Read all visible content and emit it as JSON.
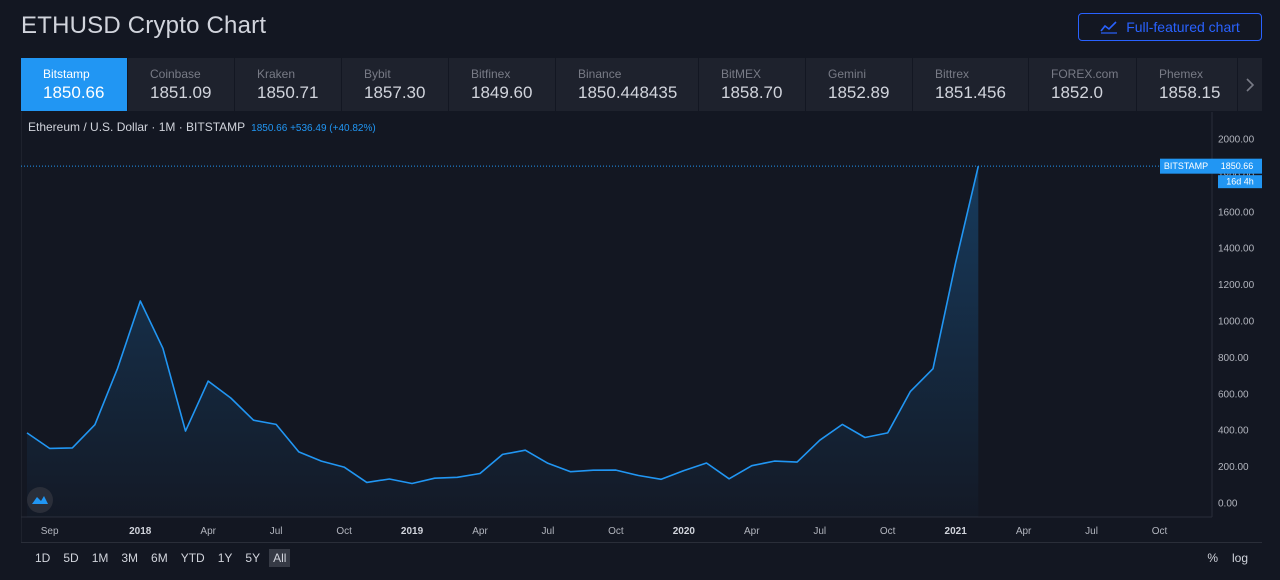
{
  "header": {
    "title": "ETHUSD Crypto Chart",
    "full_chart_label": "Full-featured chart",
    "accent": "#2962ff"
  },
  "exchanges": [
    {
      "name": "Bitstamp",
      "price": "1850.66",
      "active": true
    },
    {
      "name": "Coinbase",
      "price": "1851.09"
    },
    {
      "name": "Kraken",
      "price": "1850.71"
    },
    {
      "name": "Bybit",
      "price": "1857.30"
    },
    {
      "name": "Bitfinex",
      "price": "1849.60"
    },
    {
      "name": "Binance",
      "price": "1850.448435"
    },
    {
      "name": "BitMEX",
      "price": "1858.70"
    },
    {
      "name": "Gemini",
      "price": "1852.89"
    },
    {
      "name": "Bittrex",
      "price": "1851.456"
    },
    {
      "name": "FOREX.com",
      "price": "1852.0"
    },
    {
      "name": "Phemex",
      "price": "1858.15"
    }
  ],
  "legend": {
    "symbol": "Ethereum / U.S. Dollar · 1M · BITSTAMP",
    "values": "1850.66 +536.49 (+40.82%)"
  },
  "price_tag": {
    "label": "BITSTAMP",
    "price": "1850.66",
    "countdown": "16d 4h"
  },
  "chart_data": {
    "type": "area",
    "line_color": "#2196f3",
    "yticks": [
      "2000.00",
      "1800.00",
      "1600.00",
      "1400.00",
      "1200.00",
      "1000.00",
      "800.00",
      "600.00",
      "400.00",
      "200.00",
      "0.00"
    ],
    "ylim": [
      0,
      2000
    ],
    "xticks": [
      {
        "label": "Sep",
        "bold": false
      },
      {
        "label": "2018",
        "bold": true
      },
      {
        "label": "Apr",
        "bold": false
      },
      {
        "label": "Jul",
        "bold": false
      },
      {
        "label": "Oct",
        "bold": false
      },
      {
        "label": "2019",
        "bold": true
      },
      {
        "label": "Apr",
        "bold": false
      },
      {
        "label": "Jul",
        "bold": false
      },
      {
        "label": "Oct",
        "bold": false
      },
      {
        "label": "2020",
        "bold": true
      },
      {
        "label": "Apr",
        "bold": false
      },
      {
        "label": "Jul",
        "bold": false
      },
      {
        "label": "Oct",
        "bold": false
      },
      {
        "label": "2021",
        "bold": true
      },
      {
        "label": "Apr",
        "bold": false
      },
      {
        "label": "Jul",
        "bold": false
      },
      {
        "label": "Oct",
        "bold": false
      }
    ],
    "x": [
      "2017-08",
      "2017-09",
      "2017-10",
      "2017-11",
      "2017-12",
      "2018-01",
      "2018-02",
      "2018-03",
      "2018-04",
      "2018-05",
      "2018-06",
      "2018-07",
      "2018-08",
      "2018-09",
      "2018-10",
      "2018-11",
      "2018-12",
      "2019-01",
      "2019-02",
      "2019-03",
      "2019-04",
      "2019-05",
      "2019-06",
      "2019-07",
      "2019-08",
      "2019-09",
      "2019-10",
      "2019-11",
      "2019-12",
      "2020-01",
      "2020-02",
      "2020-03",
      "2020-04",
      "2020-05",
      "2020-06",
      "2020-07",
      "2020-08",
      "2020-09",
      "2020-10",
      "2020-11",
      "2020-12",
      "2021-01",
      "2021-02"
    ],
    "values": [
      385,
      300,
      303,
      430,
      740,
      1110,
      850,
      395,
      670,
      577,
      455,
      432,
      281,
      230,
      197,
      113,
      132,
      107,
      136,
      141,
      162,
      267,
      290,
      218,
      172,
      180,
      181,
      151,
      130,
      178,
      220,
      133,
      205,
      230,
      225,
      345,
      432,
      360,
      385,
      612,
      738,
      1320,
      1850.66
    ]
  },
  "ranges": [
    "1D",
    "5D",
    "1M",
    "3M",
    "6M",
    "YTD",
    "1Y",
    "5Y",
    "All"
  ],
  "active_range": "All",
  "scale_options": {
    "percent": "%",
    "log": "log"
  }
}
